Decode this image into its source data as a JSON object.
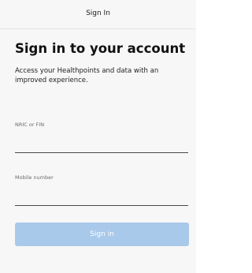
{
  "header": {
    "title": "Sign In"
  },
  "main": {
    "heading": "Sign in to your account",
    "subtitle": "Access your Healthpoints and data with an improved experience.",
    "fields": [
      {
        "label": "NRIC or FIN",
        "value": "",
        "placeholder": ""
      },
      {
        "label": "Mobile number",
        "value": "",
        "placeholder": ""
      }
    ],
    "submit_label": "Sign in"
  },
  "colors": {
    "background": "#f7f7f7",
    "button_disabled": "#a9c9ea",
    "text": "#111111"
  }
}
